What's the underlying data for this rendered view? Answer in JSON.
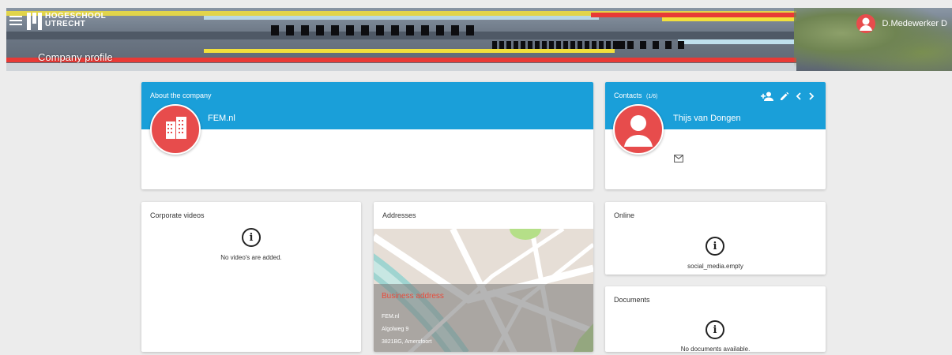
{
  "header": {
    "logo_line1": "HOGESCHOOL",
    "logo_line2": "UTRECHT",
    "page_title": "Company profile",
    "user_name": "D.Medewerker D"
  },
  "about": {
    "title": "About the company",
    "company_name": "FEM.nl"
  },
  "contacts": {
    "title": "Contacts",
    "count": "(1/6)",
    "name": "Thijs van Dongen"
  },
  "videos": {
    "title": "Corporate videos",
    "empty": "No video's are added."
  },
  "addresses": {
    "title": "Addresses",
    "type": "Business address",
    "line1": "FEM.nl",
    "line2": "Algolweg 9",
    "line3": "3821BG, Amersfoort"
  },
  "online": {
    "title": "Online",
    "empty": "social_media.empty"
  },
  "documents": {
    "title": "Documents",
    "empty": "No documents available."
  },
  "colors": {
    "primary": "#1a9fd9",
    "avatar": "#e74c4c",
    "address_label": "#e74c3c"
  }
}
